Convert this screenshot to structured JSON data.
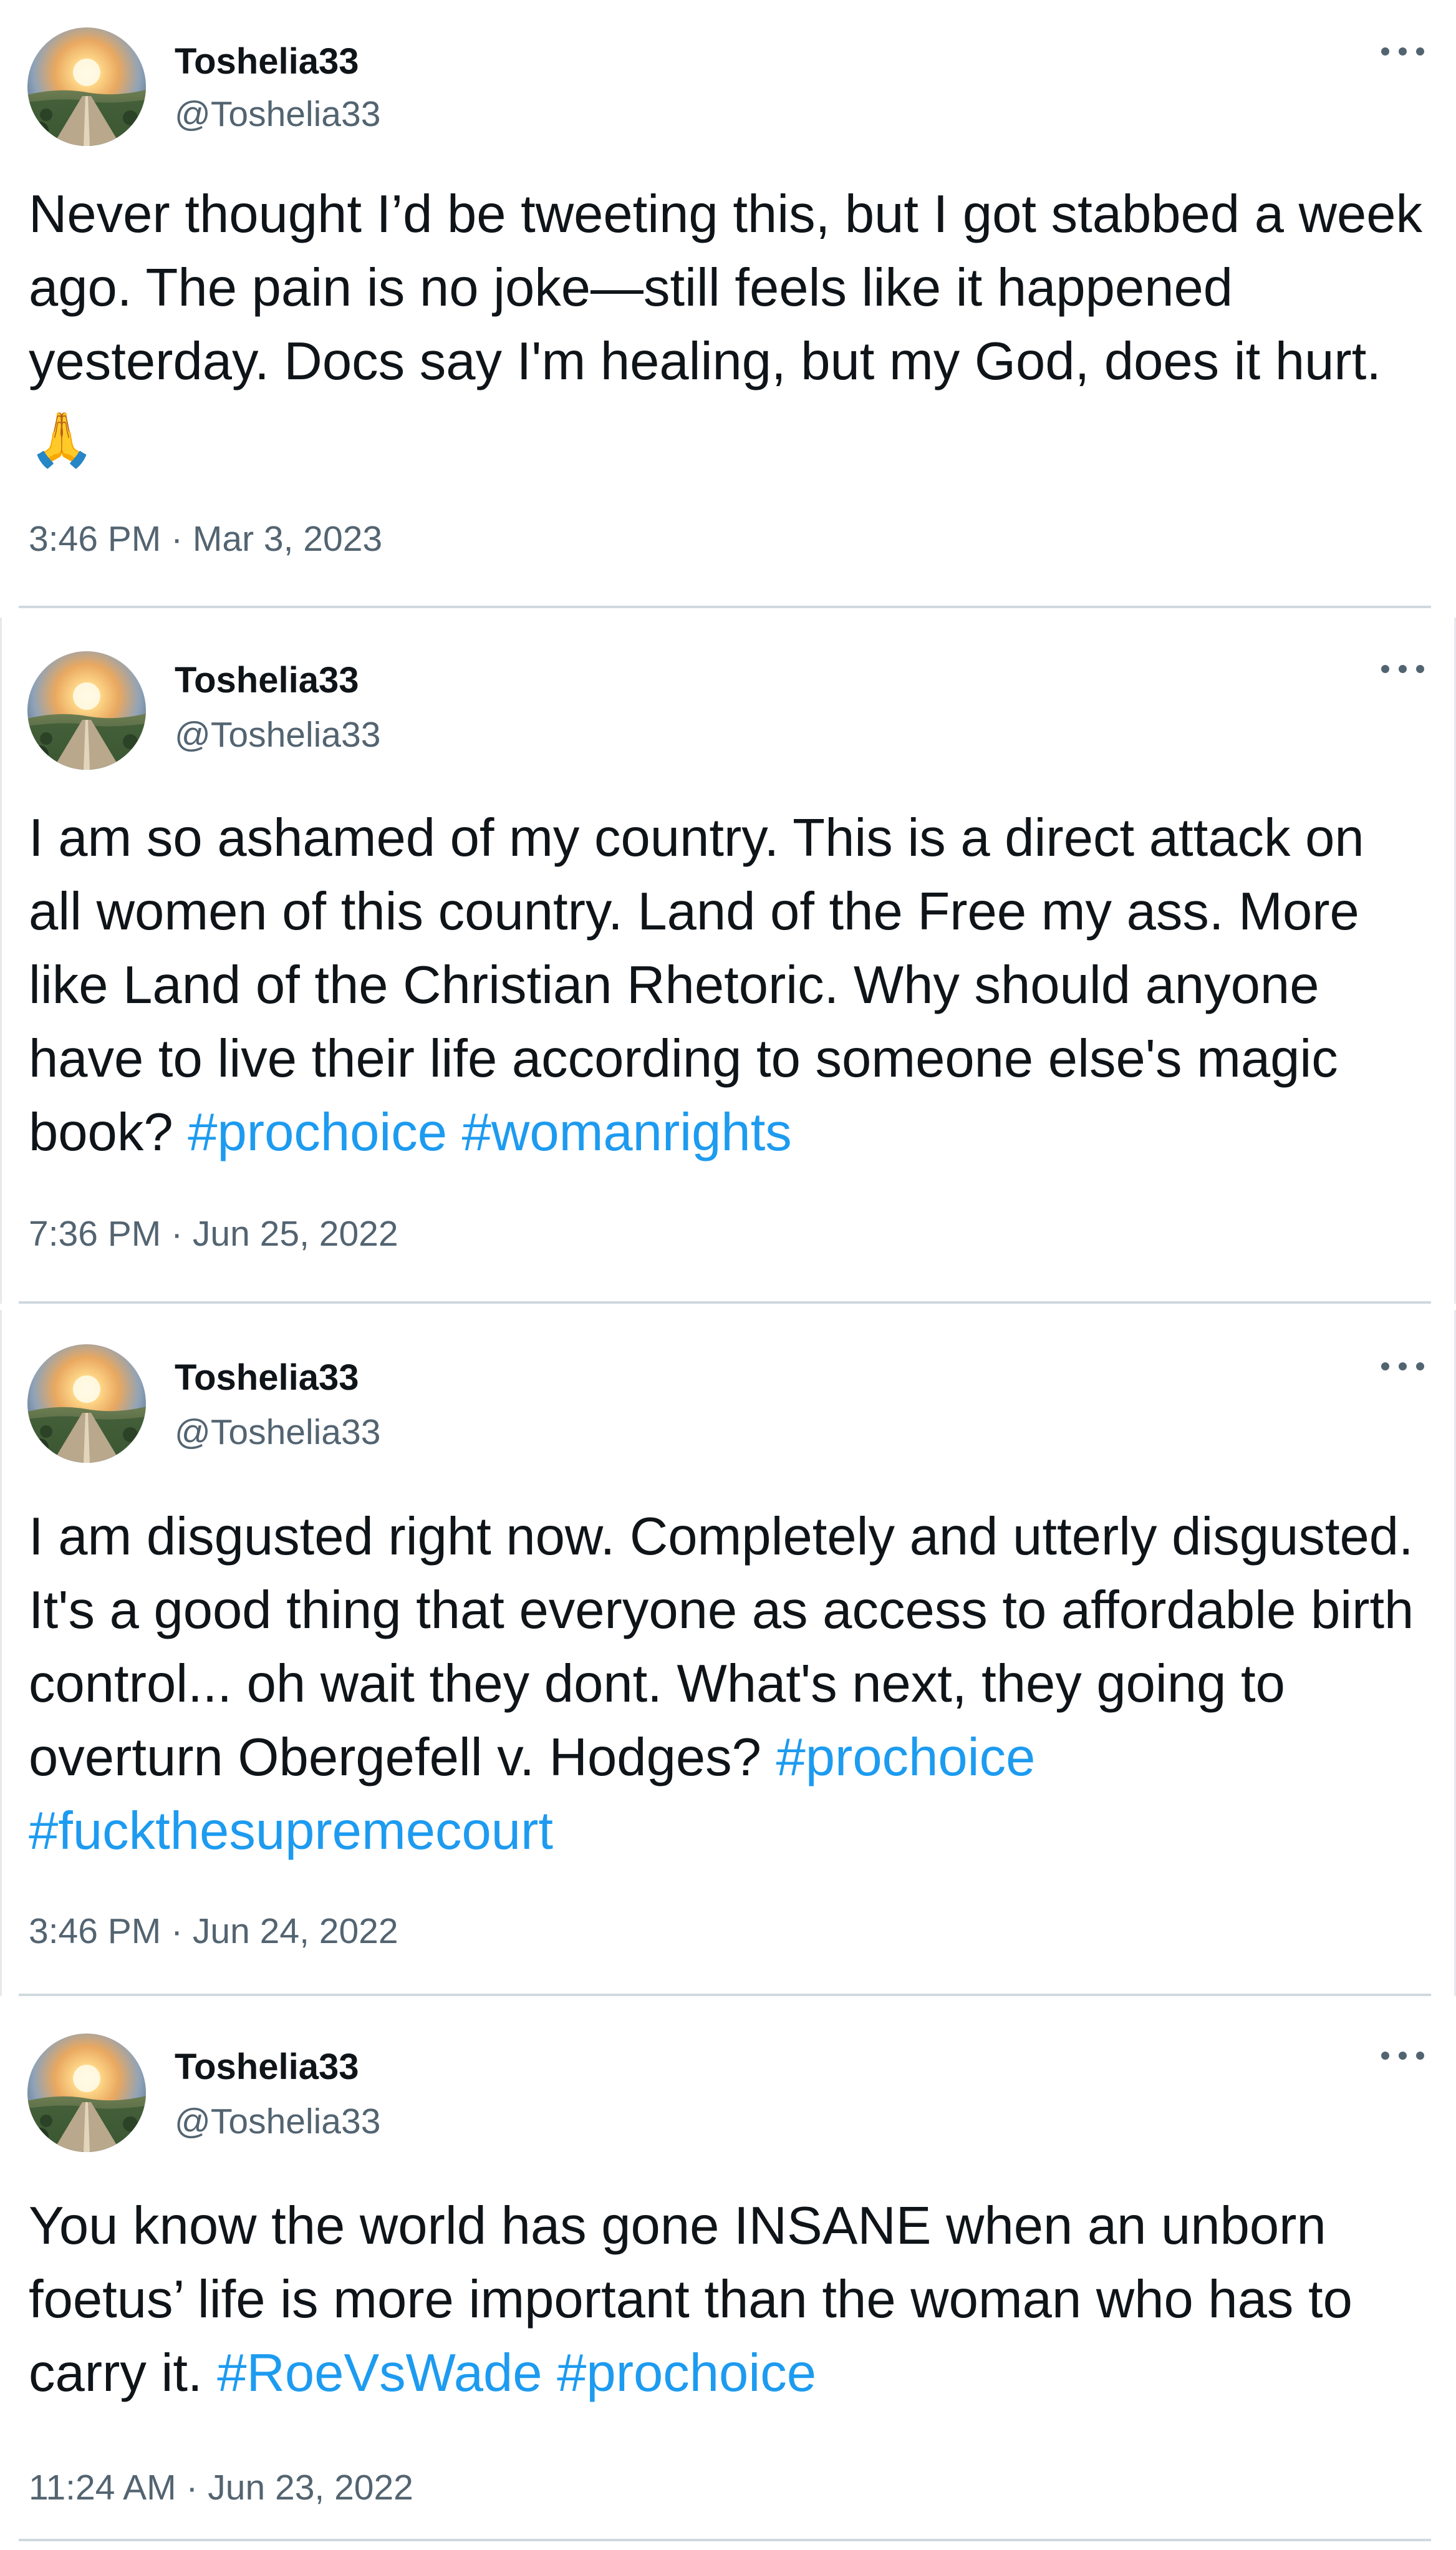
{
  "colors": {
    "text": "#0f1419",
    "secondary": "#536471",
    "hashtag": "#1d9bf0",
    "divider": "#cfd9de"
  },
  "tweets": [
    {
      "display_name": "Toshelia33",
      "handle": "@Toshelia33",
      "more_icon": "more-horizontal-icon",
      "text": "Never thought I’d be tweeting this, but I got stabbed a week ago. The pain is no joke—still feels like it happened yesterday. Docs say I'm healing, but my God, does it hurt. ",
      "emoji": "🙏",
      "hashtags": [],
      "timestamp": "3:46 PM · Mar 3, 2023"
    },
    {
      "display_name": "Toshelia33",
      "handle": "@Toshelia33",
      "more_icon": "more-horizontal-icon",
      "text": "I am so ashamed of my country. This is a direct attack on all women of this country. Land of the Free my ass. More like Land of the Christian Rhetoric. Why should anyone have to live their life according to someone else's magic book? ",
      "hashtags": [
        "#prochoice",
        "#womanrights"
      ],
      "timestamp": "7:36 PM · Jun 25, 2022"
    },
    {
      "display_name": "Toshelia33",
      "handle": "@Toshelia33",
      "more_icon": "more-horizontal-icon",
      "text": "I am disgusted right now. Completely and utterly disgusted. It's a good thing that everyone as access to affordable birth control... oh wait they dont. What's next, they going to overturn Obergefell v. Hodges? ",
      "hashtags": [
        "#prochoice",
        "#fuckthesupremecourt"
      ],
      "timestamp": "3:46 PM · Jun 24, 2022"
    },
    {
      "display_name": "Toshelia33",
      "handle": "@Toshelia33",
      "more_icon": "more-horizontal-icon",
      "text": "You know the world has gone INSANE when an unborn foetus’ life is more important than the woman who has to carry it. ",
      "hashtags": [
        "#RoeVsWade",
        "#prochoice"
      ],
      "timestamp": "11:24 AM · Jun 23, 2022"
    }
  ]
}
